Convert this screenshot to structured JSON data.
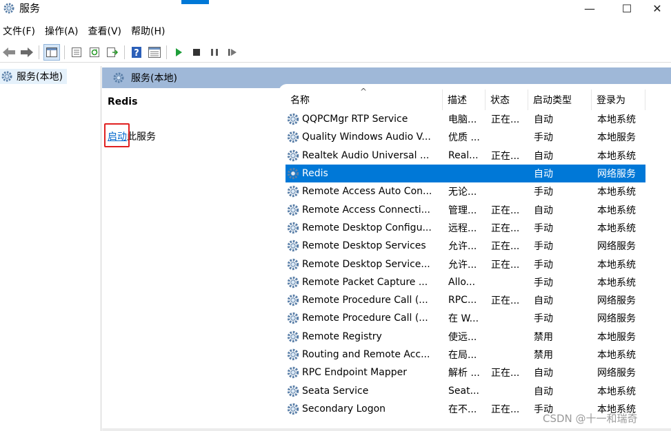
{
  "window": {
    "title": "服务",
    "minimize": "—",
    "maximize": "☐",
    "close": "✕"
  },
  "menu": [
    "文件(F)",
    "操作(A)",
    "查看(V)",
    "帮助(H)"
  ],
  "toolbar": {
    "icons": [
      "back-arrow-icon",
      "forward-arrow-icon",
      "console-tree-icon",
      "properties-icon",
      "refresh-icon",
      "export-list-icon",
      "help-icon",
      "details-view-icon",
      "start-service-icon",
      "stop-service-icon",
      "pause-service-icon",
      "restart-service-icon"
    ]
  },
  "tree": {
    "root_label": "服务(本地)"
  },
  "main": {
    "header_label": "服务(本地)",
    "detail": {
      "service_name": "Redis",
      "start_link": "启动",
      "action_suffix": "此服务"
    }
  },
  "list": {
    "sort_indicator": "^",
    "columns": [
      "名称",
      "描述",
      "状态",
      "启动类型",
      "登录为"
    ],
    "rows": [
      {
        "name": "QQPCMgr RTP Service",
        "desc": "电脑...",
        "state": "正在...",
        "start": "自动",
        "logon": "本地系统"
      },
      {
        "name": "Quality Windows Audio V...",
        "desc": "优质 ...",
        "state": "",
        "start": "手动",
        "logon": "本地服务"
      },
      {
        "name": "Realtek Audio Universal ...",
        "desc": "Real...",
        "state": "正在...",
        "start": "自动",
        "logon": "本地系统"
      },
      {
        "name": "Redis",
        "desc": "",
        "state": "",
        "start": "自动",
        "logon": "网络服务"
      },
      {
        "name": "Remote Access Auto Con...",
        "desc": "无论...",
        "state": "",
        "start": "手动",
        "logon": "本地系统"
      },
      {
        "name": "Remote Access Connecti...",
        "desc": "管理...",
        "state": "正在...",
        "start": "自动",
        "logon": "本地系统"
      },
      {
        "name": "Remote Desktop Configu...",
        "desc": "远程...",
        "state": "正在...",
        "start": "手动",
        "logon": "本地系统"
      },
      {
        "name": "Remote Desktop Services",
        "desc": "允许...",
        "state": "正在...",
        "start": "手动",
        "logon": "网络服务"
      },
      {
        "name": "Remote Desktop Service...",
        "desc": "允许...",
        "state": "正在...",
        "start": "手动",
        "logon": "本地系统"
      },
      {
        "name": "Remote Packet Capture ...",
        "desc": "Allo...",
        "state": "",
        "start": "手动",
        "logon": "本地系统"
      },
      {
        "name": "Remote Procedure Call (...",
        "desc": "RPC...",
        "state": "正在...",
        "start": "自动",
        "logon": "网络服务"
      },
      {
        "name": "Remote Procedure Call (...",
        "desc": "在 W...",
        "state": "",
        "start": "手动",
        "logon": "网络服务"
      },
      {
        "name": "Remote Registry",
        "desc": "使远...",
        "state": "",
        "start": "禁用",
        "logon": "本地服务"
      },
      {
        "name": "Routing and Remote Acc...",
        "desc": "在局...",
        "state": "",
        "start": "禁用",
        "logon": "本地系统"
      },
      {
        "name": "RPC Endpoint Mapper",
        "desc": "解析 ...",
        "state": "正在...",
        "start": "自动",
        "logon": "网络服务"
      },
      {
        "name": "Seata Service",
        "desc": "Seat...",
        "state": "",
        "start": "自动",
        "logon": "本地系统"
      },
      {
        "name": "Secondary Logon",
        "desc": "在不...",
        "state": "正在...",
        "start": "手动",
        "logon": "本地系统"
      }
    ],
    "selected_index": 3
  },
  "watermark": "CSDN @十一和瑞奇",
  "colors": {
    "selection": "#0078d7",
    "header_band": "#9fb8d8",
    "link": "#0066cc",
    "highlight_box": "#e02020"
  }
}
